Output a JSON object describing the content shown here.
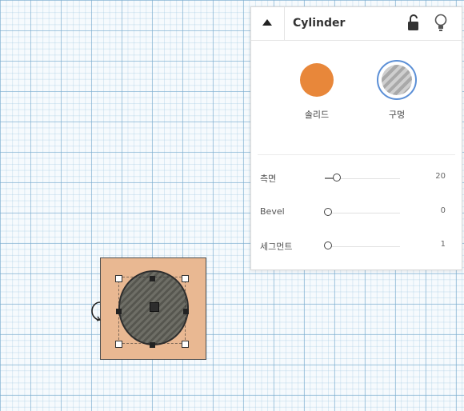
{
  "inspector": {
    "title": "Cylinder",
    "icons": {
      "collapse": "caret-up-icon",
      "lock": "unlock-icon",
      "light": "lightbulb-icon"
    },
    "type_options": [
      {
        "label": "솔리드",
        "color": "#e8873a",
        "selected": false
      },
      {
        "label": "구멍",
        "selected": true
      }
    ],
    "properties": [
      {
        "label": "측면",
        "value": "20",
        "slider_fraction": 0.12
      },
      {
        "label": "Bevel",
        "value": "0",
        "slider_fraction": 0.0
      },
      {
        "label": "세그먼트",
        "value": "1",
        "slider_fraction": 0.0
      }
    ]
  },
  "workplane": {
    "object_base_color": "#e9b892",
    "object_color": "#5d5d55"
  }
}
